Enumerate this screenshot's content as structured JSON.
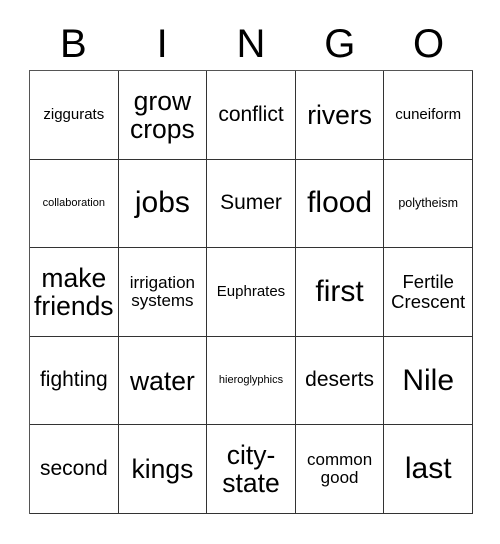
{
  "card": {
    "header_letters": [
      "B",
      "I",
      "N",
      "G",
      "O"
    ],
    "columns": 5,
    "rows": 5,
    "colors": {
      "background": "#ffffff",
      "text": "#000000",
      "grid_line": "#333333",
      "outer_grid_line": "#555555"
    },
    "cells": [
      {
        "text": "ziggurats",
        "size": "fs-s"
      },
      {
        "text": "grow\ncrops",
        "size": "fs-xxl"
      },
      {
        "text": "conflict",
        "size": "fs-l"
      },
      {
        "text": "rivers",
        "size": "fs-xxl"
      },
      {
        "text": "cuneiform",
        "size": "fs-s"
      },
      {
        "text": "collaboration",
        "size": "fs-xxs"
      },
      {
        "text": "jobs",
        "size": "fs-xxxl"
      },
      {
        "text": "Sumer",
        "size": "fs-l"
      },
      {
        "text": "flood",
        "size": "fs-xxxl"
      },
      {
        "text": "polytheism",
        "size": "fs-xs"
      },
      {
        "text": "make\nfriends",
        "size": "fs-xxl"
      },
      {
        "text": "irrigation\nsystems",
        "size": "fs-m"
      },
      {
        "text": "Euphrates",
        "size": "fs-s"
      },
      {
        "text": "first",
        "size": "fs-xxxl"
      },
      {
        "text": "Fertile\nCrescent",
        "size": "fs-ml"
      },
      {
        "text": "fighting",
        "size": "fs-l"
      },
      {
        "text": "water",
        "size": "fs-xxl"
      },
      {
        "text": "hieroglyphics",
        "size": "fs-xxs"
      },
      {
        "text": "deserts",
        "size": "fs-l"
      },
      {
        "text": "Nile",
        "size": "fs-xxxl"
      },
      {
        "text": "second",
        "size": "fs-l"
      },
      {
        "text": "kings",
        "size": "fs-xxl"
      },
      {
        "text": "city-\nstate",
        "size": "fs-xxl"
      },
      {
        "text": "common\ngood",
        "size": "fs-m"
      },
      {
        "text": "last",
        "size": "fs-xxxl"
      }
    ]
  }
}
